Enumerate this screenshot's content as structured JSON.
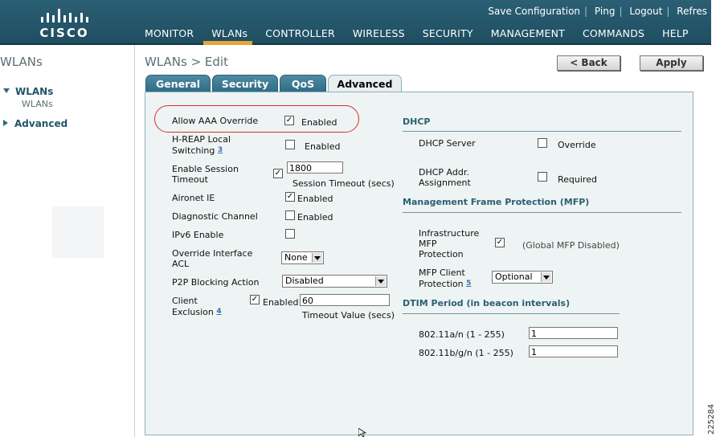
{
  "header": {
    "brand": "cisco",
    "util_links": [
      "Save Configuration",
      "Ping",
      "Logout",
      "Refres"
    ],
    "nav": [
      "MONITOR",
      "WLANs",
      "CONTROLLER",
      "WIRELESS",
      "SECURITY",
      "MANAGEMENT",
      "COMMANDS",
      "HELP"
    ],
    "active_nav": "WLANs"
  },
  "sidebar": {
    "title": "WLANs",
    "items": [
      {
        "label": "WLANs",
        "sub": "WLANs"
      },
      {
        "label": "Advanced"
      }
    ]
  },
  "content": {
    "title": "WLANs > Edit",
    "back_label": "< Back",
    "apply_label": "Apply",
    "tabs": [
      "General",
      "Security",
      "QoS",
      "Advanced"
    ],
    "active_tab": "Advanced"
  },
  "left": {
    "allow_aaa": {
      "label": "Allow AAA Override",
      "checked": true,
      "text": "Enabled"
    },
    "hreap": {
      "label1": "H-REAP Local",
      "label2": "Switching",
      "tip": "3",
      "checked": false,
      "text": "Enabled"
    },
    "session": {
      "label1": "Enable Session",
      "label2": "Timeout",
      "checked": true,
      "value": "1800",
      "suffix": "Session Timeout (secs)"
    },
    "aironet": {
      "label": "Aironet IE",
      "checked": true,
      "text": "Enabled"
    },
    "diag": {
      "label": "Diagnostic Channel",
      "checked": false,
      "text": "Enabled"
    },
    "ipv6": {
      "label": "IPv6 Enable",
      "checked": false
    },
    "acl": {
      "label1": "Override Interface",
      "label2": "ACL",
      "value": "None"
    },
    "p2p": {
      "label": "P2P Blocking Action",
      "value": "Disabled"
    },
    "client": {
      "label1": "Client",
      "label2": "Exclusion",
      "tip": "4",
      "checked": true,
      "text": "Enabled",
      "value": "60",
      "suffix": "Timeout Value (secs)"
    }
  },
  "right": {
    "dhcp_title": "DHCP",
    "dhcp_server": {
      "label": "DHCP Server",
      "checked": false,
      "text": "Override"
    },
    "dhcp_addr": {
      "label1": "DHCP Addr.",
      "label2": "Assignment",
      "checked": false,
      "text": "Required"
    },
    "mfp_title": "Management Frame Protection (MFP)",
    "infra": {
      "label1": "Infrastructure",
      "label2": "MFP",
      "label3": "Protection",
      "checked": true,
      "text": "(Global MFP Disabled)"
    },
    "mfp_client": {
      "label1": "MFP Client",
      "label2": "Protection",
      "tip": "5",
      "value": "Optional"
    },
    "dtim_title": "DTIM Period (in beacon intervals)",
    "dtim_a": {
      "label": "802.11a/n (1 - 255)",
      "value": "1"
    },
    "dtim_b": {
      "label": "802.11b/g/n (1 - 255)",
      "value": "1"
    }
  },
  "figure_id": "225284"
}
